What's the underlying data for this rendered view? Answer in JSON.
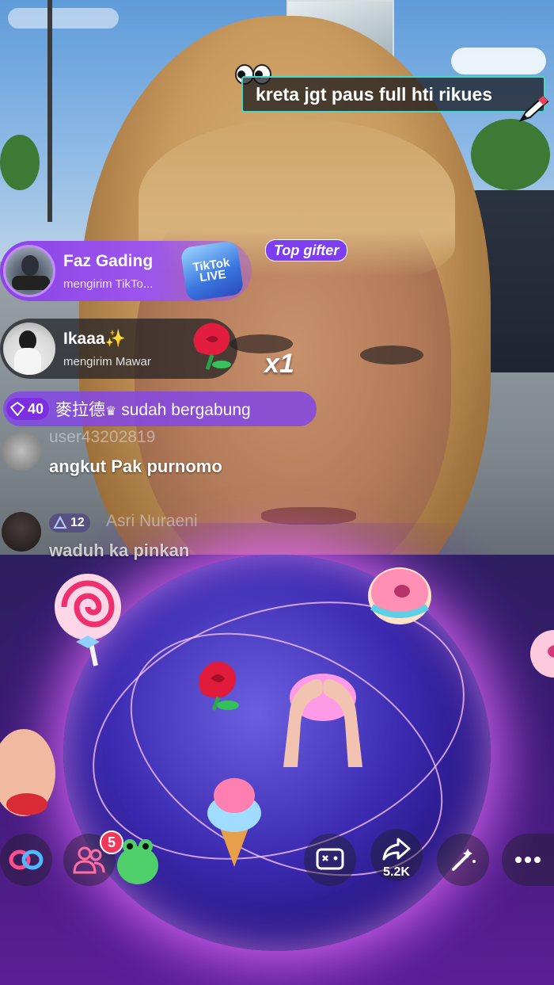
{
  "top_comment": {
    "text": "kreta jgt paus full hti rikues"
  },
  "badges": {
    "top_gifter": "Top gifter",
    "tiktok_live": "TikTok LIVE"
  },
  "gifts": [
    {
      "user": "Faz Gading",
      "action": "mengirim TikTo..."
    },
    {
      "user": "Ikaaa",
      "user_emoji": "✨",
      "action": "mengirim Mawar",
      "count": "x1"
    }
  ],
  "join_event": {
    "level": "40",
    "user": "麥拉德",
    "crown": "♛",
    "text": "sudah bergabung"
  },
  "chat": [
    {
      "user": "user43202819",
      "message": "angkut Pak purnomo"
    },
    {
      "level": "12",
      "user": "Asri Nuraeni",
      "message": "waduh ka pinkan"
    }
  ],
  "bottom_bar": {
    "friends_badge": "5",
    "share_count": "5.2K"
  },
  "colors": {
    "accent_teal": "#46d6c8",
    "gift_purple": "#8b44e6",
    "notif_red": "#f2385a"
  }
}
